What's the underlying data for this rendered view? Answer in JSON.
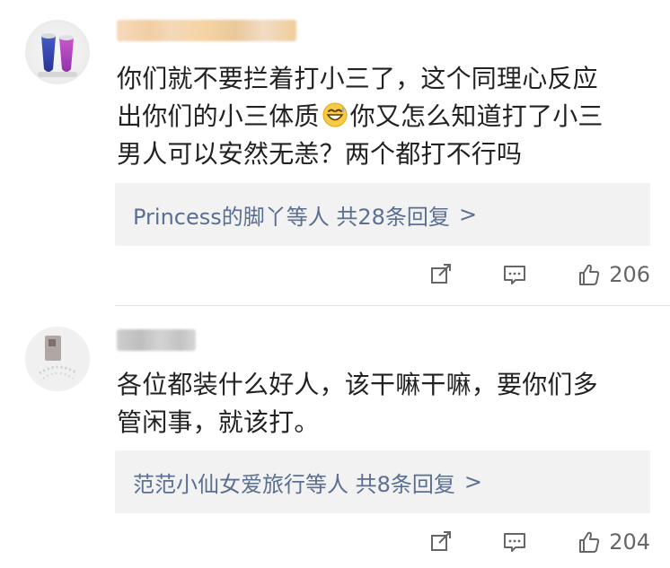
{
  "comments": [
    {
      "content_line_1": "你们就不要拦着打小三了，这个同理心反应",
      "content_line_2_before_emoji": "出你们的小三体质",
      "content_line_2_after_emoji": "你又怎么知道打了小三",
      "content_line_3": "男人可以安然无恙？两个都打不行吗",
      "replies_text": "Princess的脚丫等人  共28条回复",
      "likes": "206",
      "emoji_name": "grinning-sweat-emoji"
    },
    {
      "content_line_1": "各位都装什么好人，该干嘛干嘛，要你们多",
      "content_line_2": "管闲事，就该打。",
      "replies_text": "范范小仙女爱旅行等人  共8条回复",
      "likes": "204"
    }
  ],
  "icons": {
    "share": "share-icon",
    "comment": "comment-icon",
    "like": "like-icon",
    "chevron": "chevron-right-icon"
  },
  "colors": {
    "text": "#222222",
    "link": "#5a6f91",
    "meta": "#666666",
    "reply_bg": "#f2f2f2"
  }
}
